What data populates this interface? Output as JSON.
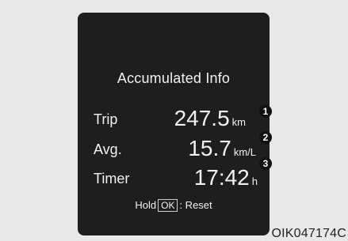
{
  "panel": {
    "title": "Accumulated Info",
    "rows": [
      {
        "label": "Trip",
        "value": "247.5",
        "unit": "km",
        "marker": "1"
      },
      {
        "label": "Avg.",
        "value": "15.7",
        "unit": "km/L",
        "marker": "2"
      },
      {
        "label": "Timer",
        "value": "17:42",
        "unit": "h",
        "marker": "3"
      }
    ],
    "hint": {
      "prefix": "Hold",
      "key": "OK",
      "suffix": ": Reset"
    }
  },
  "figure_code": "OIK047174C",
  "colors": {
    "background": "#e8e8e8",
    "screen": "#1e1e1e",
    "text": "#f2f2f2",
    "marker": "#111111"
  }
}
